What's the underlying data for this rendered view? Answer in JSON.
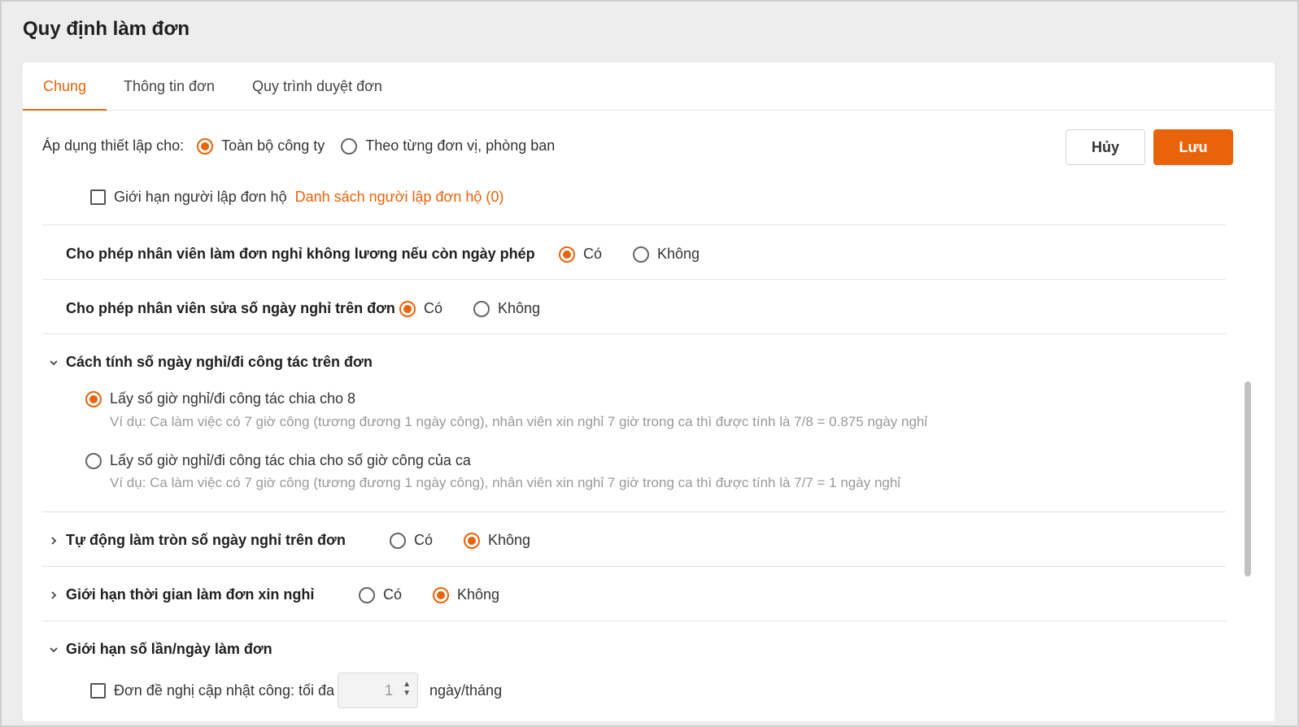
{
  "page": {
    "title": "Quy định làm đơn"
  },
  "tabs": [
    {
      "label": "Chung",
      "active": true
    },
    {
      "label": "Thông tin đơn",
      "active": false
    },
    {
      "label": "Quy trình duyệt đơn",
      "active": false
    }
  ],
  "actions": {
    "cancel_label": "Hủy",
    "save_label": "Lưu"
  },
  "apply": {
    "label": "Áp dụng thiết lập cho:",
    "options": [
      {
        "label": "Toàn bộ công ty",
        "selected": true
      },
      {
        "label": "Theo từng đơn vị, phòng ban",
        "selected": false
      }
    ]
  },
  "proxy": {
    "checkbox_label": "Giới hạn người lập đơn hộ",
    "checked": false,
    "link_label": "Danh sách người lập đơn hộ (0)"
  },
  "options_common": {
    "yes": "Có",
    "no": "Không"
  },
  "unpaid_leave": {
    "label": "Cho phép nhân viên làm đơn nghỉ không lương nếu còn ngày phép",
    "value": "yes"
  },
  "edit_days": {
    "label": "Cho phép nhân viên sửa số ngày nghỉ trên đơn",
    "value": "yes"
  },
  "calc_method": {
    "label": "Cách tính số ngày nghỉ/đi công tác trên đơn",
    "expanded": true,
    "options": [
      {
        "label": "Lấy số giờ nghỉ/đi công tác chia cho 8",
        "example": "Ví dụ: Ca làm việc có 7 giờ công (tương đương 1 ngày công), nhân viên xin nghỉ 7 giờ trong ca thì được tính là 7/8 = 0.875 ngày nghỉ",
        "selected": true
      },
      {
        "label": "Lấy số giờ nghỉ/đi công tác chia cho số giờ công của ca",
        "example": "Ví dụ: Ca làm việc có 7 giờ công (tương đương 1 ngày công), nhân viên xin nghỉ 7 giờ trong ca thì được tính là 7/7 = 1 ngày nghỉ",
        "selected": false
      }
    ]
  },
  "auto_round": {
    "label": "Tự động làm tròn số ngày nghỉ trên đơn",
    "expanded": false,
    "value": "no"
  },
  "time_limit": {
    "label": "Giới hạn thời gian làm đơn xin nghỉ",
    "expanded": false,
    "value": "no"
  },
  "count_limit": {
    "label": "Giới hạn số lần/ngày làm đơn",
    "expanded": true,
    "item": {
      "label": "Đơn đề nghị cập nhật công: tối đa",
      "checked": false,
      "value": "1",
      "unit": "ngày/tháng"
    }
  }
}
